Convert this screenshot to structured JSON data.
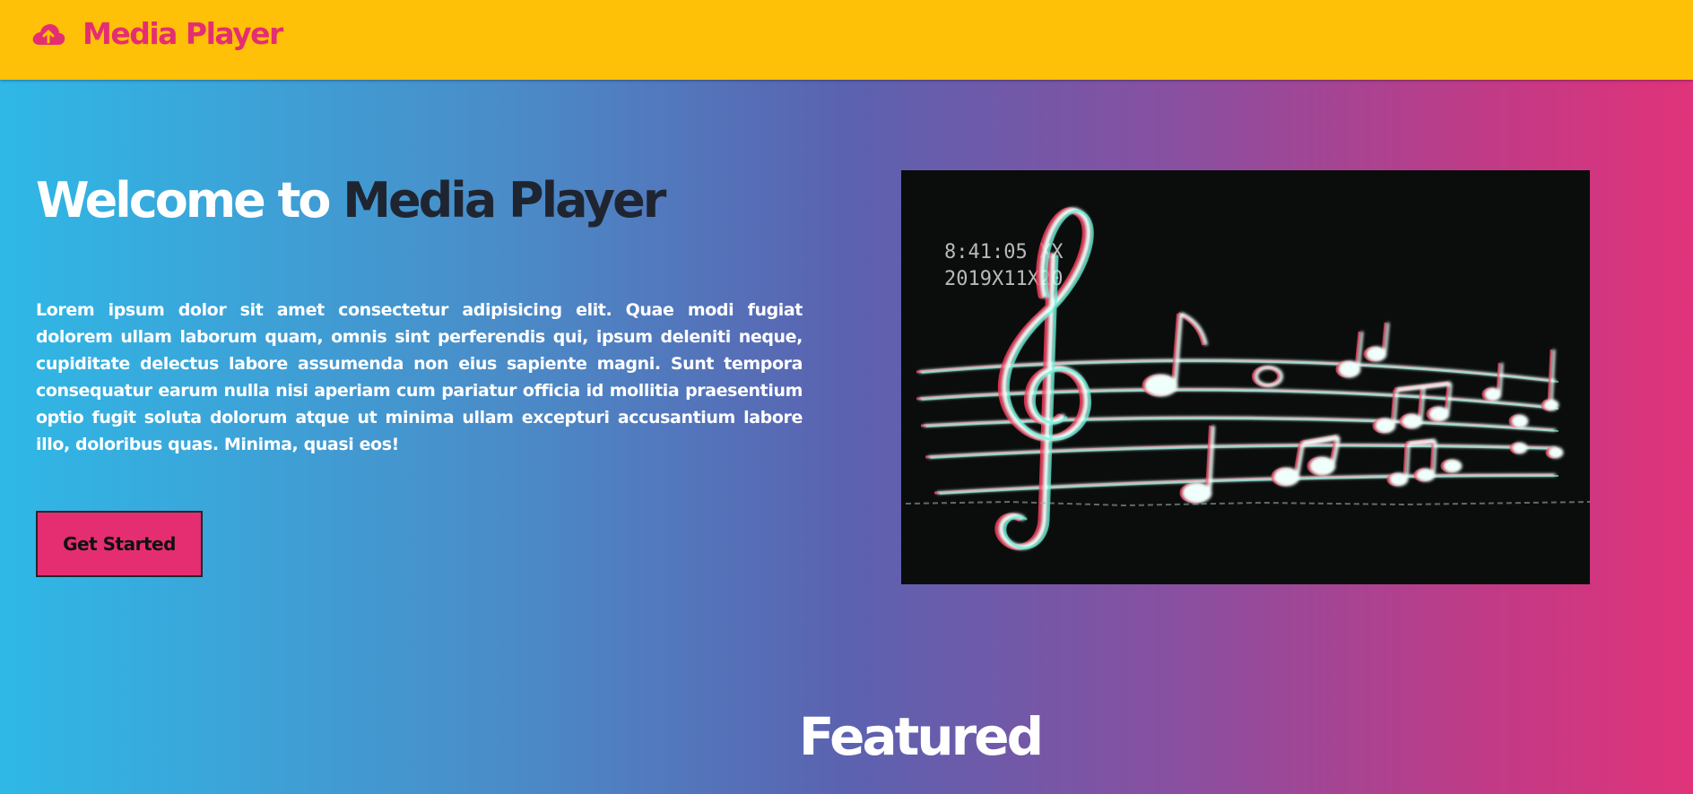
{
  "navbar": {
    "brand": "Media Player",
    "brand_icon": "cloud-upload-icon",
    "background": "#ffc107",
    "brand_color": "#e52e71"
  },
  "hero": {
    "title_part1": "Welcome to",
    "title_part2": "Media Player",
    "description": "Lorem ipsum dolor sit amet consectetur adipisicing elit. Quae modi fugiat dolorem ullam laborum quam, omnis sint perferendis qui, ipsum deleniti neque, cupiditate delectus labore assumenda non eius sapiente magni. Sunt tempora consequatur earum nulla nisi aperiam cum pariatur officia id mollitia praesentium optio fugit soluta dolorum atque ut minima ullam excepturi accusantium labore illo, doloribus quas. Minima, quasi eos!",
    "cta_label": "Get Started",
    "image": {
      "timestamp_line1": "8:41:05 XX",
      "timestamp_line2": "2019X11X20"
    }
  },
  "featured": {
    "heading": "Featured"
  },
  "colors": {
    "gradient_start": "#2fb8e6",
    "gradient_end": "#e0337a",
    "title_dark": "#1f2530",
    "accent": "#e52e71"
  }
}
